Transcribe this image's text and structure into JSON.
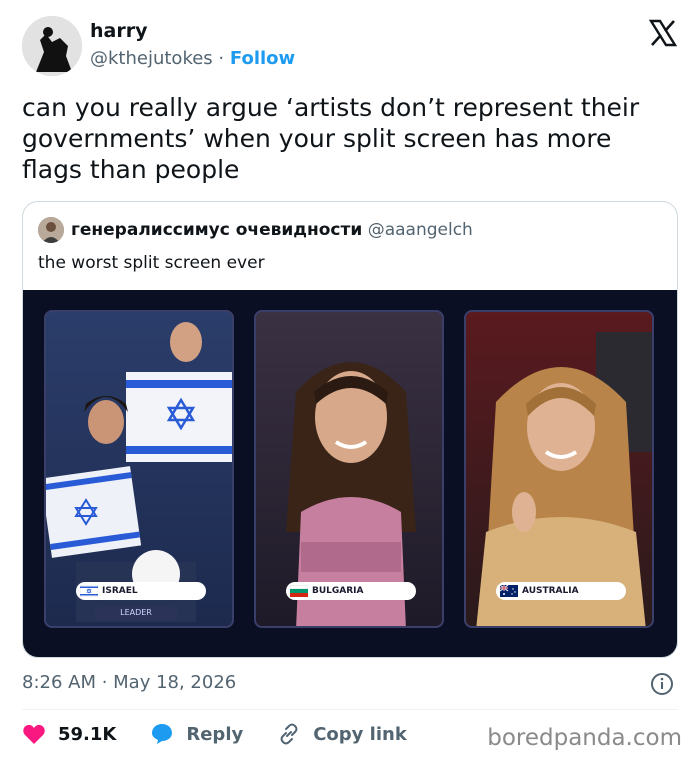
{
  "author": {
    "name": "harry",
    "handle": "@kthejutokes",
    "separator": "·",
    "follow_label": "Follow"
  },
  "tweet": {
    "text": "can you really argue ‘artists don’t represent their governments’ when your split screen has more flags than people"
  },
  "quoted": {
    "name": "генералиссимус очевидности",
    "handle": "@aaangelch",
    "text": "the worst split screen ever",
    "media": {
      "panels": [
        {
          "label": "ISRAEL",
          "sublabel": "LEADER",
          "flag": "israel-flag"
        },
        {
          "label": "BULGARIA",
          "flag": "bulgaria-flag"
        },
        {
          "label": "AUSTRALIA",
          "flag": "australia-flag"
        }
      ]
    }
  },
  "meta": {
    "timestamp": "8:26 AM · May 18, 2026"
  },
  "actions": {
    "likes": "59.1K",
    "reply_label": "Reply",
    "copy_label": "Copy link"
  },
  "watermark": "boredpanda.com",
  "colors": {
    "accent": "#1d9bf0",
    "like": "#f91880",
    "secondary_text": "#536471"
  }
}
